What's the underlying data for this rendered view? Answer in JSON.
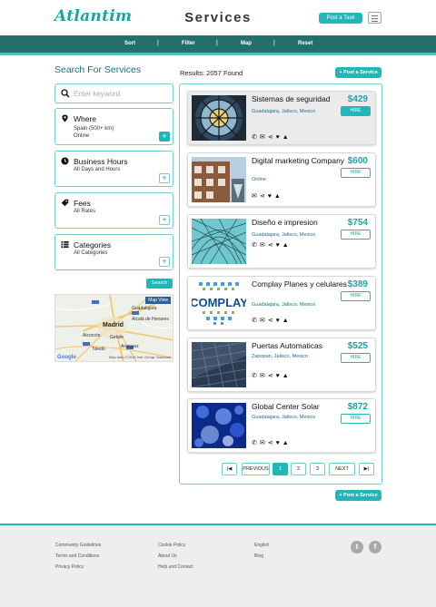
{
  "header": {
    "logo": "Atlantim",
    "title": "Services",
    "post_task_label": "Post a Task"
  },
  "nav": {
    "items": [
      "Sort",
      "Filter",
      "Map",
      "Reset"
    ]
  },
  "search": {
    "heading": "Search For Services",
    "keyword_placeholder": "Enter keyword",
    "where": {
      "title": "Where",
      "lines": [
        "Spain (500+ km)",
        "Online"
      ]
    },
    "hours": {
      "title": "Business Hours",
      "lines": [
        "All Days and Hours"
      ]
    },
    "fees": {
      "title": "Fees",
      "lines": [
        "All Rates"
      ]
    },
    "categories": {
      "title": "Categories",
      "lines": [
        "All Categories"
      ]
    },
    "search_label": "Search"
  },
  "map": {
    "view_label": "Map View",
    "city": "Madrid",
    "labels": [
      "Guadalajara",
      "Alcalá de Henares",
      "Alcorcón",
      "Getafe",
      "Toledo",
      "Aranjuez"
    ],
    "google": "Google",
    "attribution": "Map data ©2019 Inst. Geogr. Nacional"
  },
  "results": {
    "count_label": "Results: 2057 Found",
    "post_service_label": "+ Post a Service",
    "hire_label": "HIRE",
    "items": [
      {
        "name": "Sistemas de seguridad",
        "location": "Guadalajara, Jalisco, Mexico",
        "price": "$429"
      },
      {
        "name": "Digital marketing Company",
        "location": "Online",
        "price": "$600"
      },
      {
        "name": "Diseño e impresion",
        "location": "Guadalajara, Jalisco, Mexico",
        "price": "$754"
      },
      {
        "name": "Complay Planes y celulares",
        "location": "Guadalajara, Jalisco, Mexico",
        "price": "$389"
      },
      {
        "name": "Puertas Automaticas",
        "location": "Zapopan, Jalisco, Mexico",
        "price": "$525"
      },
      {
        "name": "Global Center Solar",
        "location": "Guadalajara, Jalisco, Mexico",
        "price": "$872"
      }
    ],
    "complay_logo_text": "COMPLAY"
  },
  "pagination": {
    "first": "|◀",
    "previous": "PREVIOUS",
    "pages": [
      "1",
      "2",
      "3"
    ],
    "current": "1",
    "next": "NEXT",
    "last": "▶|"
  },
  "footer": {
    "col1": [
      "Community Guidelines",
      "Terms and Conditions",
      "Privacy Policy"
    ],
    "col2": [
      "Cookie Policy",
      "About Us",
      "Help and Contact"
    ],
    "col3": [
      "English",
      "Blog"
    ],
    "social": [
      "twitter-icon",
      "facebook-icon"
    ]
  },
  "colors": {
    "accent": "#1fb7b7",
    "nav_bg": "#246e6e",
    "link": "#1a6f84"
  }
}
